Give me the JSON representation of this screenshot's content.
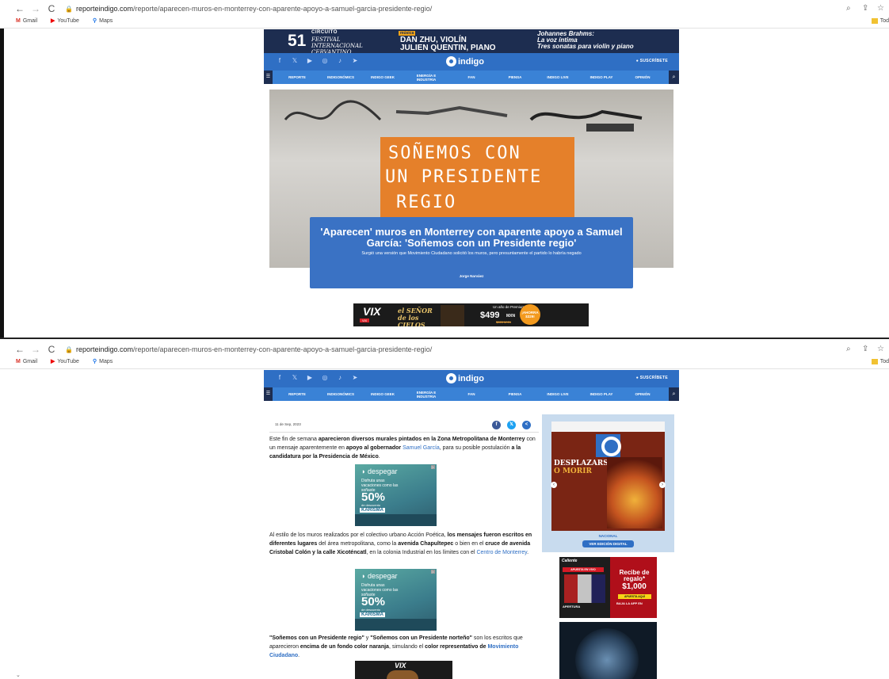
{
  "browser": {
    "url_domain": "reporteindigo.com",
    "url_path": "/reporte/aparecen-muros-en-monterrey-con-aparente-apoyo-a-samuel-garcia-presidente-regio/",
    "bookmarks": [
      {
        "label": "Gmail",
        "icon": "gmail-icon"
      },
      {
        "label": "YouTube",
        "icon": "youtube-icon"
      },
      {
        "label": "Maps",
        "icon": "maps-icon"
      }
    ],
    "bookmarks_right": "Tod"
  },
  "banner_ad": {
    "circuito": "CIRCUITO",
    "number": "51",
    "festival": "FESTIVAL INTERNACIONAL CERVANTINO",
    "tag": "música",
    "line1": "DAN ZHU, VIOLÍN",
    "line2": "JULIEN QUENTIN, PIANO",
    "brahms1": "Johannes Brahms:",
    "brahms2": "La voz íntima",
    "brahms3": "Tres sonatas para violín y piano"
  },
  "site": {
    "logo": "indigo",
    "subscribe": "SUSCRÍBETE",
    "social_icons": [
      "f",
      "𝕏",
      "▶",
      "◎",
      "♪",
      "➤"
    ],
    "menu": [
      "REPORTE",
      "INDIGONÓMICS",
      "INDIGO GEEK",
      "ENERGÍA E INDUSTRIA",
      "FAN",
      "PIENSA",
      "INDIGO LIVE",
      "INDIGO PLAY",
      "OPINIÓN"
    ]
  },
  "hero": {
    "sign_line1": "SOÑEMOS CON",
    "sign_line2": "UN PRESIDENTE",
    "sign_line3": "REGIO",
    "title": "'Aparecen' muros en Monterrey con aparente apoyo a Samuel García: 'Soñemos con un Presidente regio'",
    "subtitle": "Surgió una versión que Movimiento Ciudadano solicitó los muros, pero presuntamente el partido lo habría negado",
    "author": "Jorge Narváez"
  },
  "vix_ad": {
    "logo": "VIX",
    "sub": "ViX",
    "show": "el SEÑOR de los CIELOS",
    "promo": "Un año de Premium",
    "price": "$499",
    "currency": "MXN",
    "old_price": "$828 MXN",
    "badge1": "¡AHORRA",
    "badge2": "$329!"
  },
  "article": {
    "date": "11 de Sep, 2023",
    "share_buttons": [
      {
        "icon": "facebook-icon",
        "glyph": "f",
        "color": "#3b5998"
      },
      {
        "icon": "x-icon",
        "glyph": "𝕏",
        "color": "#1da1f2"
      },
      {
        "icon": "share-icon",
        "glyph": "<",
        "color": "#2f6fc4"
      }
    ],
    "p1": {
      "t1": "Este fin de semana ",
      "b1": "aparecieron diversos murales pintados en la Zona Metropolitana de Monterrey",
      "t2": " con un mensaje aparentemente en ",
      "b2": "apoyo al gobernador",
      "link": "Samuel García",
      "t3": ", para su posible postulación ",
      "b3": "a la candidatura por la Presidencia de México",
      "t4": "."
    },
    "p2": {
      "t1": "Al estilo de los muros realizados por el colectivo urbano Acción Poética, ",
      "b1": "los mensajes fueron escritos en diferentes lugares",
      "t2": " del área metropolitana, como la ",
      "b2": "avenida Chapultepec",
      "t3": " o bien en el ",
      "b3": "cruce de avenida Cristobal Colón y la calle Xicoténcatl",
      "t4": ", en la colonia Industrial en los límites con el ",
      "link": "Centro de Monterrey",
      "t5": "."
    },
    "p3": {
      "b1": "\"Soñemos con un Presidente regio\"",
      "t1": " y ",
      "b2": "\"Soñemos con un Presidente norteño\"",
      "t2": " son los escritos que aparecieron ",
      "b3": "encima de un fondo color naranja",
      "t3": ", simulando el ",
      "b4": "color representativo de",
      "link": "Movimiento Ciudadano",
      "t4": "."
    }
  },
  "despegar_ad": {
    "logo": "despegar",
    "text": "Disfruta unas vacaciones como las soñaste",
    "hasta": "Hasta",
    "pct": "50%",
    "desc": "de descuento",
    "brand": "KARISMA",
    "adchoice": "▷"
  },
  "magazine": {
    "title1": "DESPLAZARSE",
    "title2": "O MORIR",
    "label": "NACIONAL",
    "button": "VER EDICIÓN DIGITAL"
  },
  "caliente_ad": {
    "logo": "Caliente",
    "live": "APUESTA EN VIVO",
    "league": "APERTURA",
    "recibe": "Recibe de regalo*",
    "amount": "$1,000",
    "cta": "APUESTA AQUÍ",
    "app": "BAJA LA APP EN"
  },
  "colors": {
    "brand_blue": "#2f6fc4",
    "menu_blue": "#3a82d6",
    "dark_navy": "#1d2d50",
    "orange": "#e5802a"
  }
}
